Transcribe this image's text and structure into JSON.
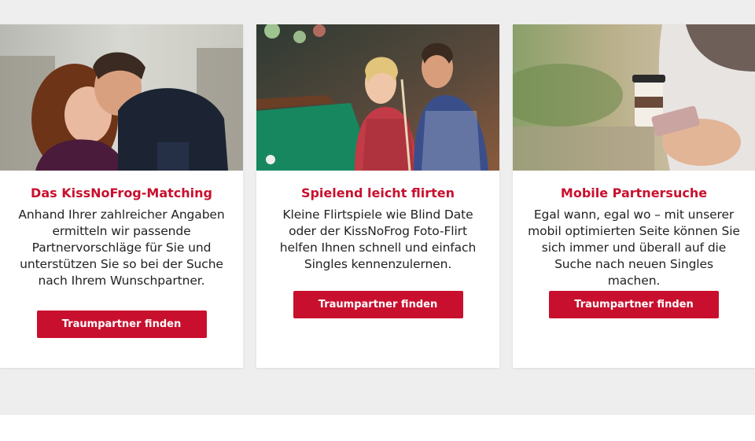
{
  "colors": {
    "accent": "#c8102e",
    "background": "#eeeeee",
    "card": "#ffffff",
    "text": "#222222"
  },
  "cards": [
    {
      "image": "couple-embracing-photo",
      "title": "Das KissNoFrog-Matching",
      "text": "Anhand Ihrer zahlreicher Angaben ermitteln wir passende Partnervorschläge für Sie und unterstützen Sie so bei der Suche nach Ihrem Wunschpartner.",
      "button": "Traumpartner finden"
    },
    {
      "image": "couple-flirting-billiards-photo",
      "title": "Spielend leicht flirten",
      "text": "Kleine Flirtspiele wie Blind Date oder der KissNoFrog Foto-Flirt helfen Ihnen schnell und einfach Singles kennenzulernen.",
      "button": "Traumpartner finden"
    },
    {
      "image": "woman-with-smartphone-photo",
      "title": "Mobile Partnersuche",
      "text": "Egal wann, egal wo – mit unserer mobil optimierten Seite können Sie sich immer und überall auf die Suche nach neuen Singles machen.",
      "button": "Traumpartner finden"
    }
  ]
}
